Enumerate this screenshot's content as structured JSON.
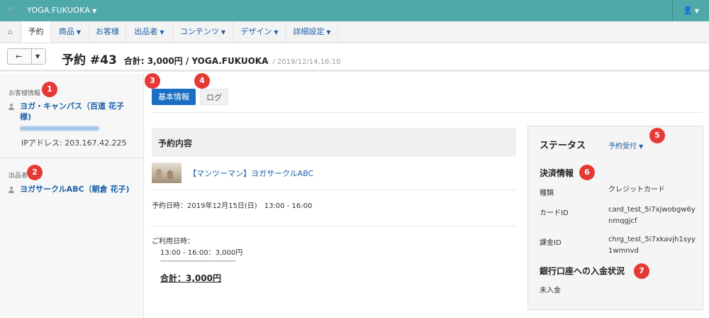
{
  "topbar": {
    "shop_icon": "cart-icon",
    "store_name": "YOGA.FUKUOKA",
    "user_icon": "user-icon"
  },
  "nav": {
    "home_icon": "home-icon",
    "items": [
      "予約",
      "商品",
      "お客様",
      "出品者",
      "コンテンツ",
      "デザイン",
      "詳細設定"
    ]
  },
  "header": {
    "title": "予約 #43",
    "summary": "合計: 3,000円 / YOGA.FUKUOKA",
    "datetime": "/ 2019/12/14,16:10"
  },
  "sidebar": {
    "customer_label": "お客様情報",
    "customer_name_line1": "ヨガ・キャンパス（百道 花子",
    "customer_name_line2": "様)",
    "ip": "IPアドレス: 203.167.42.225",
    "seller_label": "出品者",
    "seller_name": "ヨガサークルABC（朝倉 花子)"
  },
  "tabs": {
    "basic": "基本情報",
    "log": "ログ"
  },
  "content": {
    "section_title": "予約内容",
    "product_link": "【マンツーマン】ヨガサークルABC",
    "reservation_date": "予約日時：2019年12月15日(日)　13:00 - 16:00",
    "usage_label": "ご利用日時：",
    "usage_line": "13:00 - 16:00：3,000円",
    "dash_line": "-----------------------------------------",
    "total": "合計：3,000円"
  },
  "status": {
    "title": "ステータス",
    "dropdown": "予約受付",
    "payment_title": "決済情報",
    "kind_label": "種類",
    "kind_value": "クレジットカード",
    "card_label": "カードID",
    "card_value_1": "card_test_5i7xjwobgw6y",
    "card_value_2": "nmqgjcf",
    "charge_label": "課金ID",
    "charge_value_1": "chrg_test_5i7xkavjh1syy",
    "charge_value_2": "1wmnvd",
    "bank_title": "銀行口座への入金状況",
    "bank_value": "未入金"
  },
  "badges": [
    "1",
    "2",
    "3",
    "4",
    "5",
    "6",
    "7"
  ],
  "colors": {
    "topbar": "#4fa8aa",
    "primary": "#1a6fc4",
    "link": "#1a5fa8",
    "badge": "#e53935"
  }
}
